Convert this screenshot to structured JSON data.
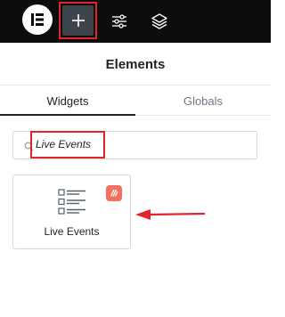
{
  "topbar": {
    "logo_icon": "elementor-logo-icon",
    "add_icon": "plus-icon",
    "settings_icon": "sliders-icon",
    "layers_icon": "layers-icon"
  },
  "panel": {
    "title": "Elements"
  },
  "tabs": [
    {
      "label": "Widgets",
      "active": true
    },
    {
      "label": "Globals",
      "active": false
    }
  ],
  "search": {
    "value": "Live Events",
    "icon": "search-icon"
  },
  "widgets": [
    {
      "label": "Live Events",
      "icon": "list-checkbox-icon",
      "badge_icon": "pro-badge-icon"
    }
  ],
  "colors": {
    "topbar_bg": "#0c0d0e",
    "add_button_bg": "#3f444b",
    "highlight_red": "#e0252b",
    "badge": "#f2705f"
  }
}
